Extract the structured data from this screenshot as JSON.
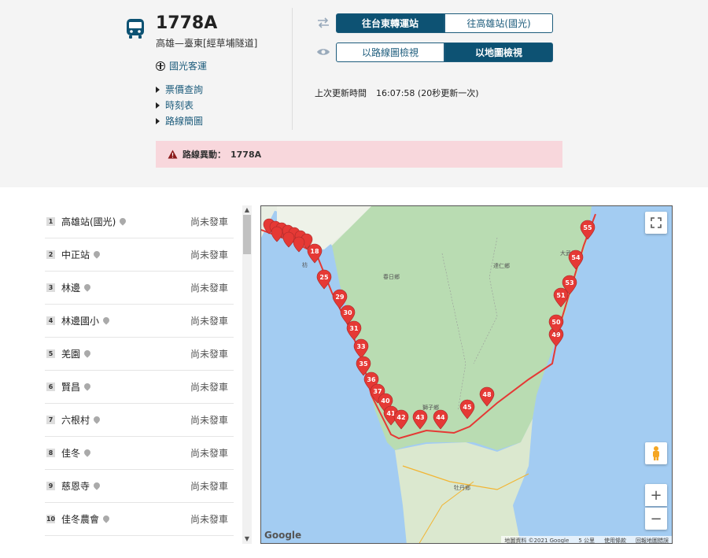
{
  "header": {
    "route_name": "1778A",
    "route_desc": "高雄—臺東[經草埔隧道]",
    "operator": "國光客運",
    "links": [
      "票價查詢",
      "時刻表",
      "路線簡圖"
    ]
  },
  "direction": {
    "options": [
      "往台東轉運站",
      "往高雄站(國光)"
    ],
    "selected": 0
  },
  "view": {
    "options": [
      "以路線圖檢視",
      "以地圖檢視"
    ],
    "selected": 1
  },
  "update": {
    "label": "上次更新時間",
    "time": "16:07:58 (20秒更新一次)"
  },
  "alert": {
    "label": "路線異動：",
    "route": "1778A"
  },
  "stops": [
    {
      "num": "1",
      "name": "高雄站(國光)",
      "status": "尚未發車"
    },
    {
      "num": "2",
      "name": "中正站",
      "status": "尚未發車"
    },
    {
      "num": "3",
      "name": "林邊",
      "status": "尚未發車"
    },
    {
      "num": "4",
      "name": "林邊國小",
      "status": "尚未發車"
    },
    {
      "num": "5",
      "name": "羌園",
      "status": "尚未發車"
    },
    {
      "num": "6",
      "name": "賢昌",
      "status": "尚未發車"
    },
    {
      "num": "7",
      "name": "六根村",
      "status": "尚未發車"
    },
    {
      "num": "8",
      "name": "佳冬",
      "status": "尚未發車"
    },
    {
      "num": "9",
      "name": "慈恩寺",
      "status": "尚未發車"
    },
    {
      "num": "10",
      "name": "佳冬農會",
      "status": "尚未發車"
    }
  ],
  "map": {
    "towns": [
      "春日鄉",
      "達仁鄉",
      "大武鄉",
      "獅子鄉",
      "牡丹鄉",
      "枋"
    ],
    "google_label": "Google",
    "attribution": [
      "地圖資料 ©2021 Google",
      "5 公里",
      "使用條款",
      "回報地圖錯誤"
    ],
    "markers": [
      "18",
      "25",
      "29",
      "30",
      "31",
      "33",
      "35",
      "36",
      "37",
      "40",
      "41",
      "42",
      "43",
      "44",
      "45",
      "48",
      "49",
      "50",
      "51",
      "53",
      "54",
      "55"
    ],
    "route_color": "#e53935",
    "fullscreen_icon": "fullscreen-icon",
    "pegman_icon": "pegman-icon",
    "zoom_in": "+",
    "zoom_out": "−"
  },
  "colors": {
    "primary": "#0d5273",
    "alert_bg": "#f8d7dc",
    "alert_icon": "#8b1a1a",
    "marker": "#e53935"
  }
}
